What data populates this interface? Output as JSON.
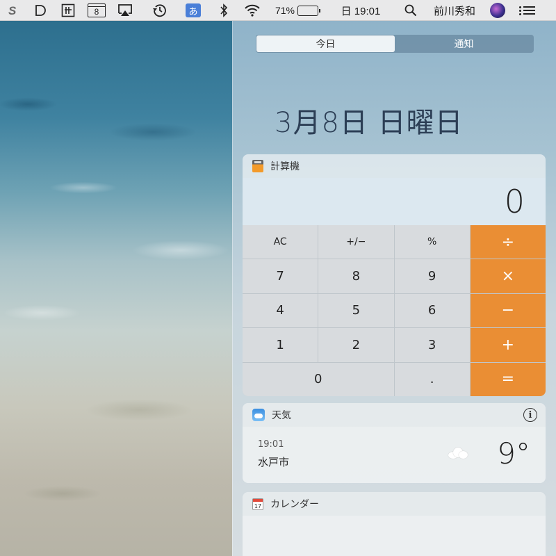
{
  "menubar": {
    "battery_percent": "71%",
    "battery_level": 0.71,
    "calendar_day": "8",
    "ime_label": "あ",
    "clock": "日 19:01",
    "user_name": "前川秀和",
    "icons": [
      "dropbox-s-icon",
      "d-app-icon",
      "grid-app-icon",
      "calendar-icon",
      "airplay-icon",
      "time-machine-icon",
      "input-method-icon",
      "bluetooth-icon",
      "wifi-icon",
      "battery-icon",
      "spotlight-search-icon",
      "siri-icon",
      "notification-center-icon"
    ]
  },
  "notification_center": {
    "tabs": [
      {
        "label": "今日",
        "active": true
      },
      {
        "label": "通知",
        "active": false
      }
    ],
    "date_heading": "3月8日 日曜日"
  },
  "calculator": {
    "title": "計算機",
    "display": "0",
    "keys": [
      {
        "label": "AC",
        "kind": "fn"
      },
      {
        "label": "+/−",
        "kind": "fn"
      },
      {
        "label": "%",
        "kind": "fn"
      },
      {
        "label": "÷",
        "kind": "op"
      },
      {
        "label": "7",
        "kind": "num"
      },
      {
        "label": "8",
        "kind": "num"
      },
      {
        "label": "9",
        "kind": "num"
      },
      {
        "label": "×",
        "kind": "op"
      },
      {
        "label": "4",
        "kind": "num"
      },
      {
        "label": "5",
        "kind": "num"
      },
      {
        "label": "6",
        "kind": "num"
      },
      {
        "label": "−",
        "kind": "op"
      },
      {
        "label": "1",
        "kind": "num"
      },
      {
        "label": "2",
        "kind": "num"
      },
      {
        "label": "3",
        "kind": "num"
      },
      {
        "label": "+",
        "kind": "op"
      },
      {
        "label": "0",
        "kind": "zero"
      },
      {
        "label": ".",
        "kind": "num"
      },
      {
        "label": "=",
        "kind": "op"
      }
    ],
    "accent_color": "#ea8e34"
  },
  "weather": {
    "title": "天気",
    "time": "19:01",
    "city": "水戸市",
    "temperature": "9°",
    "condition_icon": "cloud-icon"
  },
  "calendar": {
    "title": "カレンダー",
    "icon_day": "17"
  }
}
